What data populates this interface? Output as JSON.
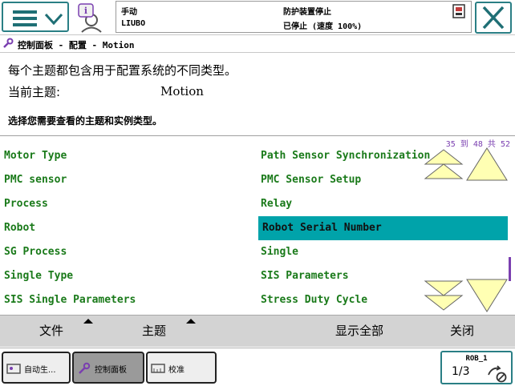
{
  "header": {
    "status": {
      "mode": "手动",
      "controller": "LIUBO",
      "safety": "防护装置停止",
      "state": "已停止 (速度 100%)"
    }
  },
  "breadcrumb": "控制面板 - 配置 - Motion",
  "description": {
    "line1": "每个主题都包含用于配置系统的不同类型。",
    "topic_label": "当前主题:",
    "topic_value": "Motion",
    "instruction": "选择您需要查看的主题和实例类型。"
  },
  "list": {
    "page_counter": "35 到 48 共 52",
    "left_column": [
      "Motor Type",
      "PMC sensor",
      "Process",
      "Robot",
      "SG Process",
      "Single Type",
      "SIS Single Parameters"
    ],
    "right_column": [
      "Path Sensor Synchronization",
      "PMC Sensor Setup",
      "Relay",
      "Robot Serial Number",
      "Single",
      "SIS Parameters",
      "Stress Duty Cycle"
    ],
    "selected": "Robot Serial Number",
    "scroll_position": 0.7
  },
  "command_bar": {
    "file": "文件",
    "topic": "主题",
    "show_all": "显示全部",
    "close": "关闭"
  },
  "taskbar": {
    "tasks": [
      "自动生...",
      "控制面板",
      "校准"
    ],
    "active": "控制面板",
    "robot_name": "ROB_1",
    "robot_fraction": "1/3"
  },
  "colors": {
    "accent": "#2a7f85",
    "list_text": "#1a7a1a",
    "selection": "#00a3aa",
    "scroll_arrow": "#ffffb3",
    "counter": "#7a3fb0",
    "command_bar": "#d3d3d3"
  },
  "icons": {
    "menu": "hamburger-menu-icon",
    "user": "user-info-icon",
    "lock": "operating-mode-icon",
    "close": "close-x-icon",
    "breadcrumb": "control-panel-icon",
    "scroll_up": "scroll-up-icon",
    "scroll_down": "scroll-down-icon",
    "robot": "robot-status-icon"
  }
}
